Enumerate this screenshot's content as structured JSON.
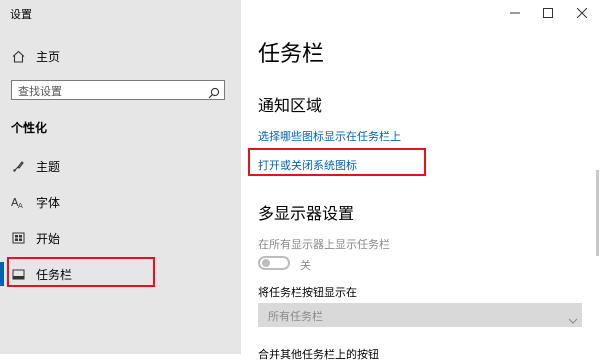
{
  "window": {
    "title": "设置"
  },
  "sidebar": {
    "home_label": "主页",
    "search_placeholder": "查找设置",
    "section_title": "个性化",
    "items": [
      {
        "label": "主题",
        "icon": "theme-icon"
      },
      {
        "label": "字体",
        "icon": "font-icon"
      },
      {
        "label": "开始",
        "icon": "start-icon"
      },
      {
        "label": "任务栏",
        "icon": "taskbar-icon",
        "selected": true
      }
    ]
  },
  "main": {
    "title": "任务栏",
    "notification": {
      "heading": "通知区域",
      "link_select_icons": "选择哪些图标显示在任务栏上",
      "link_system_icons": "打开或关闭系统图标"
    },
    "multi_display": {
      "heading": "多显示器设置",
      "show_taskbar_label": "在所有显示器上显示任务栏",
      "toggle_state": "关",
      "buttons_label": "将任务栏按钮显示在",
      "buttons_value": "所有任务栏",
      "cutoff_text": "合并其他任务栏上的按钮"
    }
  },
  "colors": {
    "accent": "#0063b1",
    "highlight": "#e81123",
    "sidebar_bg": "#e6e6e6"
  }
}
